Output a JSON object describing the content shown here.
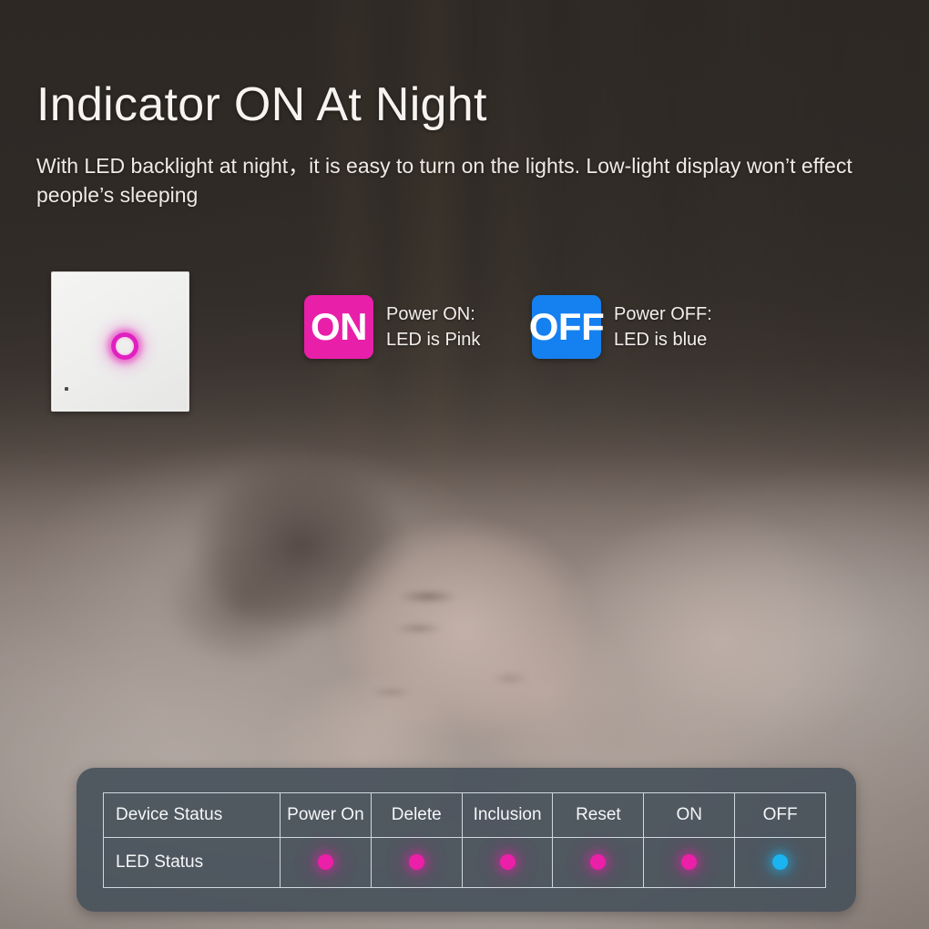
{
  "page": {
    "headline": "Indicator ON At Night",
    "subhead": "With LED backlight at night，it is easy to turn on the lights. Low-light display won’t effect people’s sleeping"
  },
  "device": {
    "panel_name": "wall-touch-switch",
    "indicator_color": "#e020c0",
    "indicator_state": "on"
  },
  "legend": {
    "on": {
      "badge_label": "ON",
      "badge_color": "#e81fa9",
      "line1": "Power ON:",
      "line2": "LED is Pink"
    },
    "off": {
      "badge_label": "OFF",
      "badge_color": "#1580f0",
      "line1": "Power OFF:",
      "line2": "LED is blue"
    }
  },
  "status_table": {
    "row_labels": [
      "Device Status",
      "LED Status"
    ],
    "columns": [
      "Power On",
      "Delete",
      "Inclusion",
      "Reset",
      "ON",
      "OFF"
    ],
    "led_states": [
      "pink",
      "pink",
      "pink",
      "pink",
      "pink",
      "blue"
    ],
    "colors": {
      "pink": "#ec1fa8",
      "blue": "#1ab4f0",
      "panel": "#46505a",
      "border": "#cfd8de"
    }
  }
}
